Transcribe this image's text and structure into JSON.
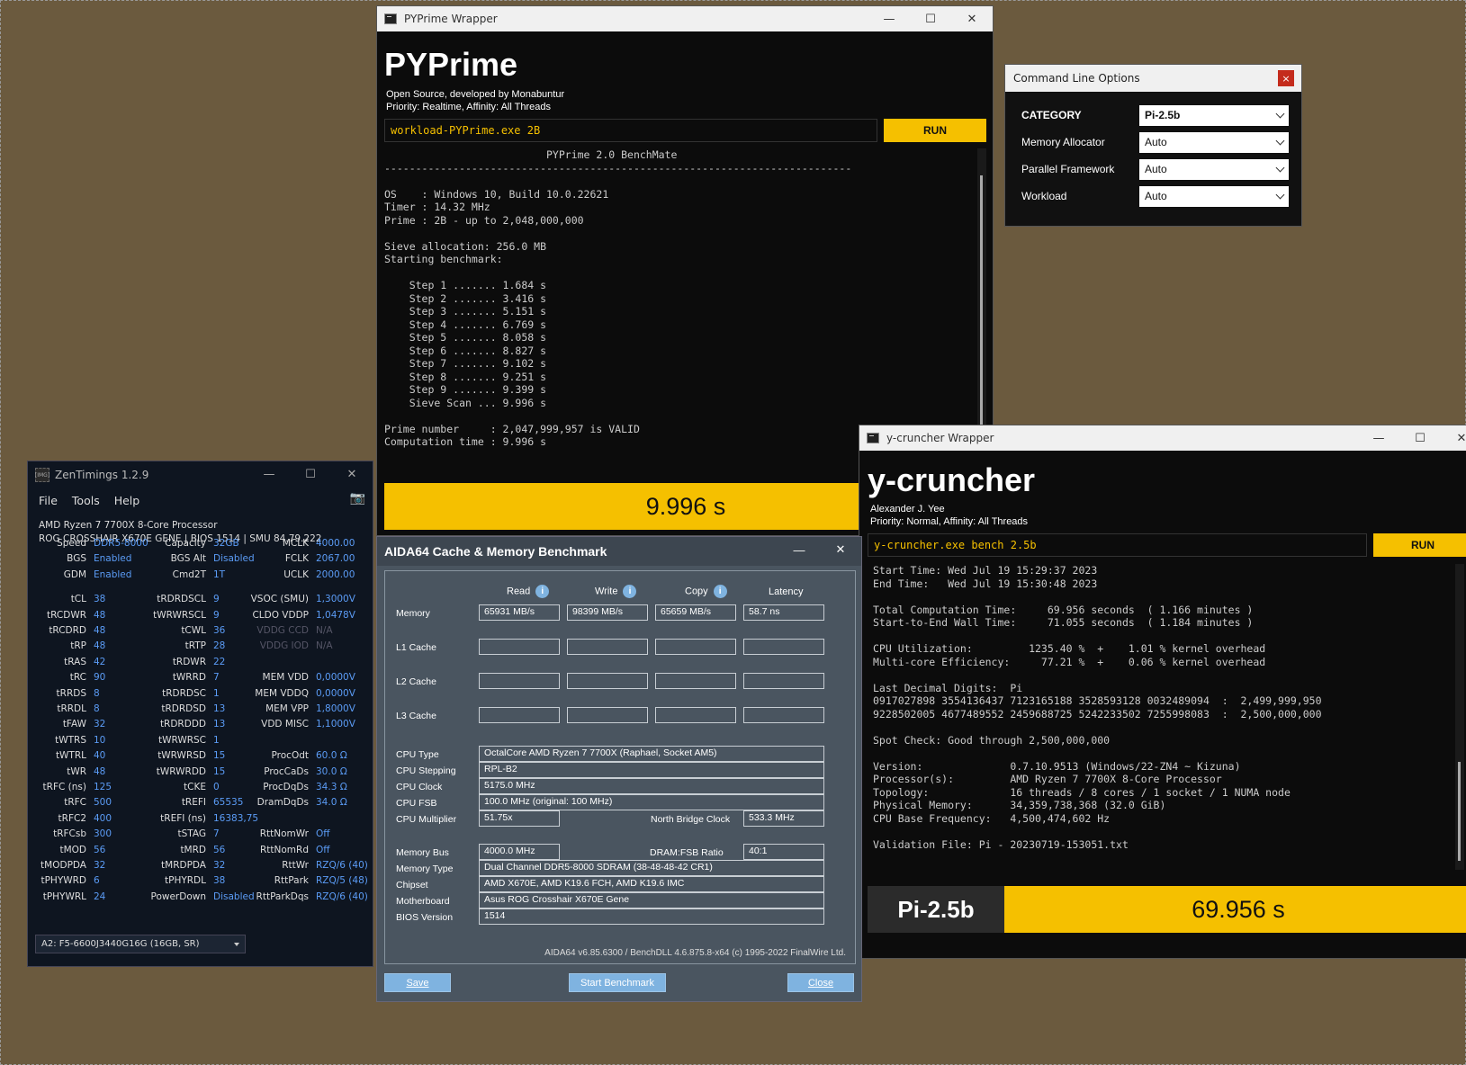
{
  "wallpaper": {
    "alt": "blurred autumn forest road wallpaper"
  },
  "pyprime": {
    "window_title": "PYPrime Wrapper",
    "app_title": "PYPrime",
    "subtitle1": "Open Source, developed by Monabuntur",
    "subtitle2": "Priority: Realtime, Affinity: All Threads",
    "command": "workload-PYPrime.exe 2B",
    "run_label": "RUN",
    "output": [
      "                          PYPrime 2.0 BenchMate",
      "---------------------------------------------------------------------------",
      "",
      "OS    : Windows 10, Build 10.0.22621",
      "Timer : 14.32 MHz",
      "Prime : 2B - up to 2,048,000,000",
      "",
      "Sieve allocation: 256.0 MB",
      "Starting benchmark:",
      "",
      "    Step 1 ....... 1.684 s",
      "    Step 2 ....... 3.416 s",
      "    Step 3 ....... 5.151 s",
      "    Step 4 ....... 6.769 s",
      "    Step 5 ....... 8.058 s",
      "    Step 6 ....... 8.827 s",
      "    Step 7 ....... 9.102 s",
      "    Step 8 ....... 9.251 s",
      "    Step 9 ....... 9.399 s",
      "    Sieve Scan ... 9.996 s",
      "",
      "Prime number     : 2,047,999,957 is VALID",
      "Computation time : 9.996 s"
    ],
    "result": "9.996 s"
  },
  "cmdopts": {
    "title": "Command Line Options",
    "close": "×",
    "rows": [
      {
        "label": "CATEGORY",
        "value": "Pi-2.5b"
      },
      {
        "label": "Memory Allocator",
        "value": "Auto"
      },
      {
        "label": "Parallel Framework",
        "value": "Auto"
      },
      {
        "label": "Workload",
        "value": "Auto"
      }
    ]
  },
  "ycruncher": {
    "window_title": "y-cruncher Wrapper",
    "app_title": "y-cruncher",
    "subtitle1": "Alexander J. Yee",
    "subtitle2": "Priority: Normal, Affinity: All Threads",
    "command": "y-cruncher.exe bench 2.5b",
    "run_label": "RUN",
    "output": [
      "Start Time: Wed Jul 19 15:29:37 2023",
      "End Time:   Wed Jul 19 15:30:48 2023",
      "",
      "Total Computation Time:     69.956 seconds  ( 1.166 minutes )",
      "Start-to-End Wall Time:     71.055 seconds  ( 1.184 minutes )",
      "",
      "CPU Utilization:         1235.40 %  +    1.01 % kernel overhead",
      "Multi-core Efficiency:     77.21 %  +    0.06 % kernel overhead",
      "",
      "Last Decimal Digits:  Pi",
      "0917027898 3554136437 7123165188 3528593128 0032489094  :  2,499,999,950",
      "9228502005 4677489552 2459688725 5242233502 7255998083  :  2,500,000,000",
      "",
      "Spot Check: Good through 2,500,000,000",
      "",
      "Version:              0.7.10.9513 (Windows/22-ZN4 ~ Kizuna)",
      "Processor(s):         AMD Ryzen 7 7700X 8-Core Processor",
      "Topology:             16 threads / 8 cores / 1 socket / 1 NUMA node",
      "Physical Memory:      34,359,738,368 (32.0 GiB)",
      "CPU Base Frequency:   4,500,474,602 Hz",
      "",
      "Validation File: Pi - 20230719-153051.txt"
    ],
    "result_label": "Pi-2.5b",
    "result": "69.956 s"
  },
  "zentimings": {
    "window_title": "ZenTimings 1.2.9",
    "menu": [
      "File",
      "Tools",
      "Help"
    ],
    "cpu": "AMD Ryzen 7 7700X 8-Core Processor",
    "board": "ROG CROSSHAIR X670E GENE | BIOS 1514 | SMU 84.79.222",
    "col1": [
      [
        "Speed",
        "DDR5-8000"
      ],
      [
        "BGS",
        "Enabled"
      ],
      [
        "GDM",
        "Enabled"
      ],
      [
        "",
        ""
      ],
      [
        "tCL",
        "38"
      ],
      [
        "tRCDWR",
        "48"
      ],
      [
        "tRCDRD",
        "48"
      ],
      [
        "tRP",
        "48"
      ],
      [
        "tRAS",
        "42"
      ],
      [
        "tRC",
        "90"
      ],
      [
        "tRRDS",
        "8"
      ],
      [
        "tRRDL",
        "8"
      ],
      [
        "tFAW",
        "32"
      ],
      [
        "tWTRS",
        "10"
      ],
      [
        "tWTRL",
        "40"
      ],
      [
        "tWR",
        "48"
      ],
      [
        "tRFC (ns)",
        "125"
      ],
      [
        "tRFC",
        "500"
      ],
      [
        "tRFC2",
        "400"
      ],
      [
        "tRFCsb",
        "300"
      ],
      [
        "tMOD",
        "56"
      ],
      [
        "tMODPDA",
        "32"
      ],
      [
        "tPHYWRD",
        "6"
      ],
      [
        "tPHYWRL",
        "24"
      ]
    ],
    "col2": [
      [
        "Capacity",
        "32GB"
      ],
      [
        "BGS Alt",
        "Disabled"
      ],
      [
        "Cmd2T",
        "1T"
      ],
      [
        "",
        ""
      ],
      [
        "tRDRDSCL",
        "9"
      ],
      [
        "tWRWRSCL",
        "9"
      ],
      [
        "tCWL",
        "36"
      ],
      [
        "tRTP",
        "28"
      ],
      [
        "tRDWR",
        "22"
      ],
      [
        "tWRRD",
        "7"
      ],
      [
        "tRDRDSC",
        "1"
      ],
      [
        "tRDRDSD",
        "13"
      ],
      [
        "tRDRDDD",
        "13"
      ],
      [
        "tWRWRSC",
        "1"
      ],
      [
        "tWRWRSD",
        "15"
      ],
      [
        "tWRWRDD",
        "15"
      ],
      [
        "tCKE",
        "0"
      ],
      [
        "tREFI",
        "65535"
      ],
      [
        "tREFI (ns)",
        "16383,75"
      ],
      [
        "tSTAG",
        "7"
      ],
      [
        "tMRD",
        "56"
      ],
      [
        "tMRDPDA",
        "32"
      ],
      [
        "tPHYRDL",
        "38"
      ],
      [
        "PowerDown",
        "Disabled"
      ]
    ],
    "col3": [
      [
        "MCLK",
        "4000.00"
      ],
      [
        "FCLK",
        "2067.00"
      ],
      [
        "UCLK",
        "2000.00"
      ],
      [
        "",
        ""
      ],
      [
        "VSOC (SMU)",
        "1,3000V"
      ],
      [
        "CLDO VDDP",
        "1,0478V"
      ],
      [
        "VDDG CCD",
        "N/A"
      ],
      [
        "VDDG IOD",
        "N/A"
      ],
      [
        "",
        ""
      ],
      [
        "MEM VDD",
        "0,0000V"
      ],
      [
        "MEM VDDQ",
        "0,0000V"
      ],
      [
        "MEM VPP",
        "1,8000V"
      ],
      [
        "VDD MISC",
        "1,1000V"
      ],
      [
        "",
        ""
      ],
      [
        "ProcOdt",
        "60.0 Ω"
      ],
      [
        "ProcCaDs",
        "30.0 Ω"
      ],
      [
        "ProcDqDs",
        "34.3 Ω"
      ],
      [
        "DramDqDs",
        "34.0 Ω"
      ],
      [
        "",
        ""
      ],
      [
        "RttNomWr",
        "Off"
      ],
      [
        "RttNomRd",
        "Off"
      ],
      [
        "RttWr",
        "RZQ/6 (40)"
      ],
      [
        "RttPark",
        "RZQ/5 (48)"
      ],
      [
        "RttParkDqs",
        "RZQ/6 (40)"
      ]
    ],
    "dimm": "A2: F5-6600J3440G16G (16GB, SR)"
  },
  "aida": {
    "title": "AIDA64 Cache & Memory Benchmark",
    "headers": [
      "Read",
      "Write",
      "Copy",
      "Latency"
    ],
    "rows": [
      {
        "label": "Memory",
        "values": [
          "65931 MB/s",
          "98399 MB/s",
          "65659 MB/s",
          "58.7 ns"
        ]
      },
      {
        "label": "L1 Cache",
        "values": [
          "",
          "",
          "",
          ""
        ]
      },
      {
        "label": "L2 Cache",
        "values": [
          "",
          "",
          "",
          ""
        ]
      },
      {
        "label": "L3 Cache",
        "values": [
          "",
          "",
          "",
          ""
        ]
      }
    ],
    "cpu_type_label": "CPU Type",
    "cpu_type": "OctalCore AMD Ryzen 7 7700X  (Raphael, Socket AM5)",
    "cpu_stepping_label": "CPU Stepping",
    "cpu_stepping": "RPL-B2",
    "cpu_clock_label": "CPU Clock",
    "cpu_clock": "5175.0 MHz",
    "cpu_fsb_label": "CPU FSB",
    "cpu_fsb": "100.0 MHz  (original: 100 MHz)",
    "cpu_mult_label": "CPU Multiplier",
    "cpu_mult": "51.75x",
    "nb_clock_label": "North Bridge Clock",
    "nb_clock": "533.3 MHz",
    "mem_bus_label": "Memory Bus",
    "mem_bus": "4000.0 MHz",
    "ratio_label": "DRAM:FSB Ratio",
    "ratio": "40:1",
    "mem_type_label": "Memory Type",
    "mem_type": "Dual Channel DDR5-8000 SDRAM  (38-48-48-42 CR1)",
    "chipset_label": "Chipset",
    "chipset": "AMD X670E, AMD K19.6 FCH, AMD K19.6 IMC",
    "mobo_label": "Motherboard",
    "mobo": "Asus ROG Crosshair X670E Gene",
    "bios_label": "BIOS Version",
    "bios": "1514",
    "footer": "AIDA64 v6.85.6300 / BenchDLL 4.6.875.8-x64  (c) 1995-2022 FinalWire Ltd.",
    "save": "Save",
    "start": "Start Benchmark",
    "close": "Close"
  },
  "icons": {
    "minimize": "—",
    "maximize": "☐",
    "close": "✕",
    "camera": "📷"
  }
}
